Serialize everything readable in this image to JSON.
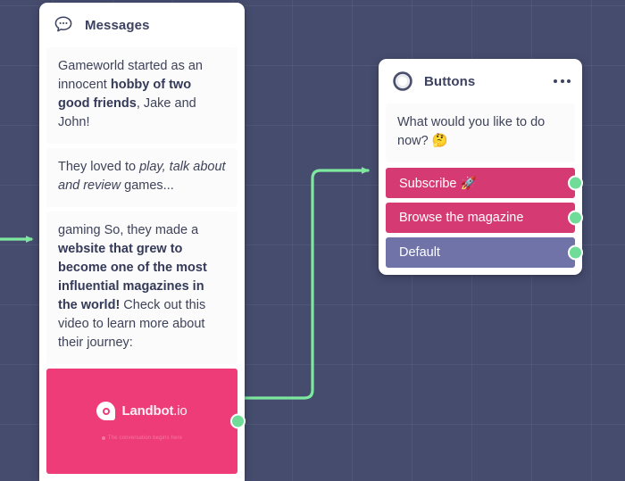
{
  "canvas": {
    "background_color": "#464c6d",
    "grid_line_color": "rgba(255,255,255,0.055)",
    "connector_color": "#7ee89f"
  },
  "messages_card": {
    "title": "Messages",
    "icon": "speech-bubble-icon",
    "messages": [
      {
        "id": "msg-1",
        "parts": [
          {
            "text": "Gameworld started as an innocent ",
            "style": "normal"
          },
          {
            "text": "hobby of two good friends",
            "style": "bold"
          },
          {
            "text": ", Jake and John!",
            "style": "normal"
          }
        ]
      },
      {
        "id": "msg-2",
        "parts": [
          {
            "text": "They loved to ",
            "style": "normal"
          },
          {
            "text": "play, talk about and review",
            "style": "italic"
          },
          {
            "text": " games...",
            "style": "normal"
          }
        ]
      },
      {
        "id": "msg-3",
        "parts": [
          {
            "text": "gaming So, they made a ",
            "style": "normal"
          },
          {
            "text": "website that grew to become one of the most influential magazines in the world!",
            "style": "bold"
          },
          {
            "text": " Check out this video to learn more about their journey:",
            "style": "normal"
          }
        ]
      }
    ],
    "video": {
      "brand": "Landbot",
      "brand_suffix": ".io",
      "subtitle": "The conversation begins here",
      "background_color": "#ee3c78"
    }
  },
  "buttons_card": {
    "title": "Buttons",
    "icon": "ring-icon",
    "menu_icon": "more-options-icon",
    "prompt": "What would you like to do now? 🤔",
    "buttons": [
      {
        "label": "Subscribe 🚀",
        "color": "#d53a73"
      },
      {
        "label": "Browse the magazine",
        "color": "#d53a73"
      },
      {
        "label": "Default",
        "color": "#6f73a8"
      }
    ]
  }
}
